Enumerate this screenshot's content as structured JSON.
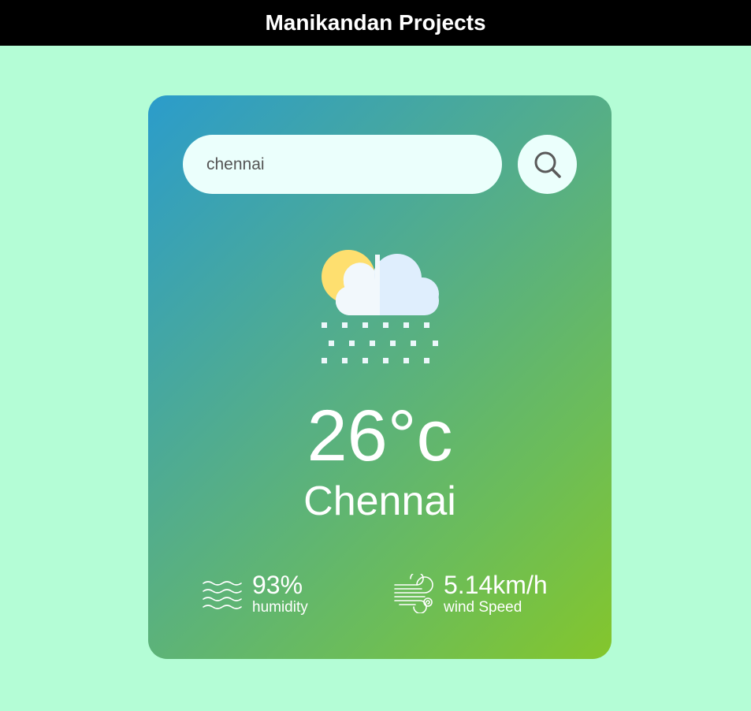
{
  "header": {
    "title": "Manikandan Projects"
  },
  "search": {
    "value": "chennai",
    "placeholder": "enter city name"
  },
  "weather": {
    "icon": "sun-cloud-snow-icon",
    "temperature": "26°c",
    "city": "Chennai"
  },
  "details": {
    "humidity": {
      "value": "93%",
      "label": "humidity",
      "icon": "humidity-waves-icon"
    },
    "wind": {
      "value": "5.14km/h",
      "label": "wind Speed",
      "icon": "wind-icon"
    }
  },
  "colors": {
    "background": "#b4fdd6",
    "header_bg": "#000000",
    "card_gradient_start": "#2b9ccb",
    "card_gradient_end": "#84c62c",
    "input_bg": "#ebfffc"
  }
}
